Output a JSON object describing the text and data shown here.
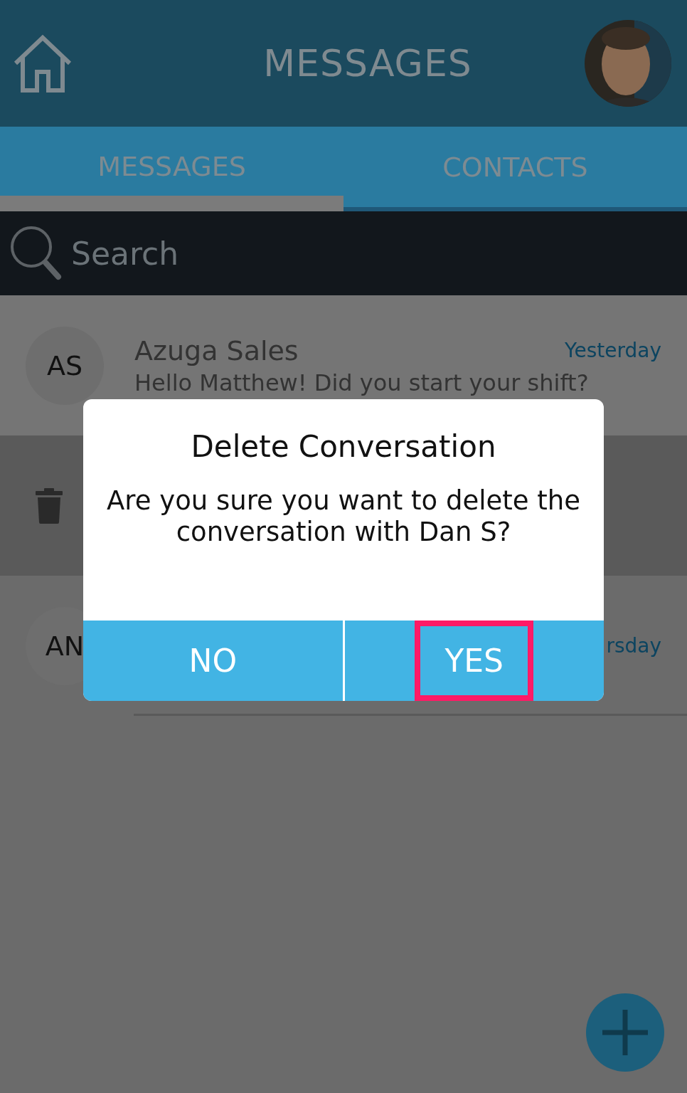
{
  "header": {
    "title": "MESSAGES"
  },
  "tabs": [
    {
      "label": "MESSAGES",
      "selected": true
    },
    {
      "label": "CONTACTS",
      "selected": false
    }
  ],
  "search": {
    "placeholder": "Search"
  },
  "conversations": [
    {
      "kind": "message",
      "initials": "AS",
      "name": "Azuga Sales",
      "time": "Yesterday",
      "preview": "Hello Matthew! Did you start your shift?"
    },
    {
      "kind": "swiped"
    },
    {
      "kind": "message",
      "initials": "AN",
      "time": "rsday"
    }
  ],
  "dialog": {
    "title": "Delete Conversation",
    "message": "Are you sure you want to delete the conversation with Dan S?",
    "buttons": [
      {
        "label": "NO",
        "highlighted": false
      },
      {
        "label": "YES",
        "highlighted": true
      }
    ]
  }
}
